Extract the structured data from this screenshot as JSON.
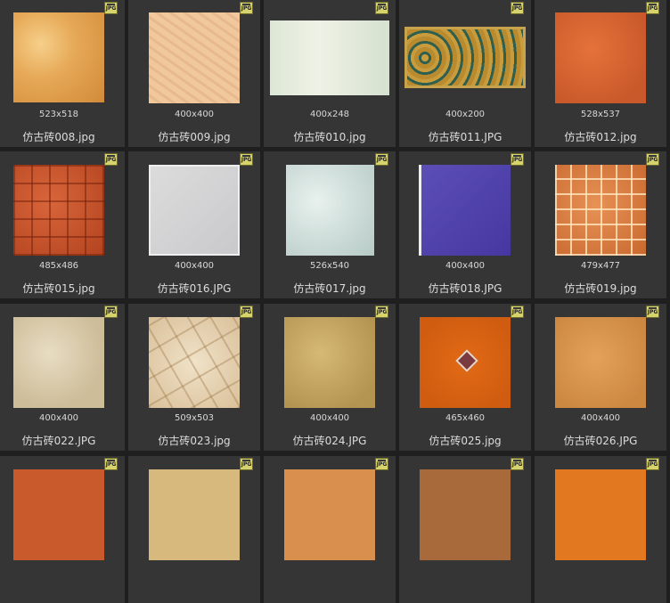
{
  "badge_label": "JPG",
  "rows": [
    [
      {
        "name": "仿古砖008.jpg",
        "dims": "523x518",
        "texture": "t008"
      },
      {
        "name": "仿古砖009.jpg",
        "dims": "400x400",
        "texture": "t009"
      },
      {
        "name": "仿古砖010.jpg",
        "dims": "400x248",
        "texture": "t010"
      },
      {
        "name": "仿古砖011.JPG",
        "dims": "400x200",
        "texture": "t011"
      },
      {
        "name": "仿古砖012.jpg",
        "dims": "528x537",
        "texture": "t012"
      }
    ],
    [
      {
        "name": "仿古砖015.jpg",
        "dims": "485x486",
        "texture": "t015"
      },
      {
        "name": "仿古砖016.JPG",
        "dims": "400x400",
        "texture": "t016"
      },
      {
        "name": "仿古砖017.jpg",
        "dims": "526x540",
        "texture": "t017"
      },
      {
        "name": "仿古砖018.JPG",
        "dims": "400x400",
        "texture": "t018"
      },
      {
        "name": "仿古砖019.jpg",
        "dims": "479x477",
        "texture": "t019"
      }
    ],
    [
      {
        "name": "仿古砖022.JPG",
        "dims": "400x400",
        "texture": "t022"
      },
      {
        "name": "仿古砖023.jpg",
        "dims": "509x503",
        "texture": "t023"
      },
      {
        "name": "仿古砖024.JPG",
        "dims": "400x400",
        "texture": "t024"
      },
      {
        "name": "仿古砖025.jpg",
        "dims": "465x460",
        "texture": "t025"
      },
      {
        "name": "仿古砖026.JPG",
        "dims": "400x400",
        "texture": "t026"
      }
    ]
  ],
  "partial_row": [
    {
      "texture": "tA"
    },
    {
      "texture": "tB"
    },
    {
      "texture": "tC"
    },
    {
      "texture": "tD"
    },
    {
      "texture": "tE"
    }
  ]
}
